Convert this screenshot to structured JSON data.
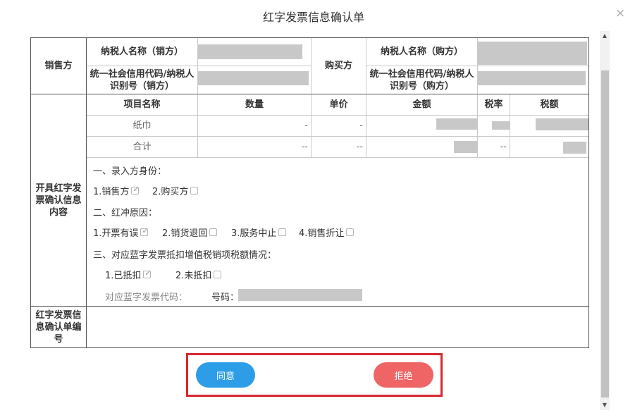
{
  "dialog": {
    "title": "红字发票信息确认单",
    "close_glyph": "×"
  },
  "scrollbar": {
    "up_glyph": "▲",
    "down_glyph": "▼"
  },
  "table": {
    "seller_label": "销售方",
    "buyer_label": "购买方",
    "seller_name_label": "纳税人名称（销方）",
    "seller_id_label": "统一社会信用代码/纳税人识别号（销方）",
    "buyer_name_label": "纳税人名称（购方）",
    "buyer_id_label": "统一社会信用代码/纳税人识别号（购方）",
    "content_label": "开具红字发票确认信息内容",
    "headers": [
      "项目名称",
      "数量",
      "单价",
      "金额",
      "税率",
      "税额"
    ],
    "rows": [
      {
        "name": "纸巾",
        "qty": "-",
        "price": "-",
        "rate": ""
      },
      {
        "name": "合计",
        "qty": "--",
        "price": "--",
        "rate": "--"
      }
    ],
    "confirm_no_label": "红字发票信息确认单编号"
  },
  "info": {
    "section1": "一、录入方身份：",
    "role_seller": "1.销售方",
    "role_buyer": "2.购买方",
    "section2": "二、红冲原因：",
    "reason1": "1.开票有误",
    "reason2": "2.销货退回",
    "reason3": "3.服务中止",
    "reason4": "4.销售折让",
    "section3": "三、对应蓝字发票抵扣增值税销项税额情况：",
    "deduct_yes": "1.已抵扣",
    "deduct_no": "2.未抵扣",
    "blue_code_label": "对应蓝字发票代码：",
    "number_label": "号码："
  },
  "buttons": {
    "agree": "同意",
    "reject": "拒绝"
  },
  "colors": {
    "agree": "#2e9de8",
    "reject": "#ef6464",
    "highlight_border": "#d9262e"
  }
}
